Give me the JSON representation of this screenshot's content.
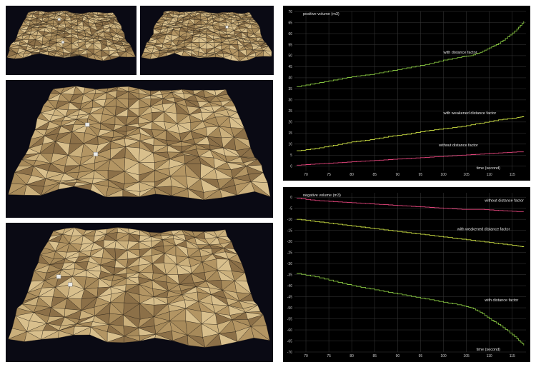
{
  "colors": {
    "terrain_light": "#cbb07c",
    "terrain_mid": "#b39563",
    "terrain_dark": "#8c7048",
    "terrain_line": "#2a2318",
    "panel_bg": "#0a0a14",
    "chart_bg": "#000000",
    "grid": "#3a3a3a",
    "series_green": "#86c441",
    "series_yellow": "#cde043",
    "series_pink": "#e0447a"
  },
  "chart_data": [
    {
      "type": "line",
      "ylabel": "positive volume (m3)",
      "xlabel": "time (second)",
      "xlim": [
        67.5,
        118
      ],
      "ylim": [
        -2,
        70
      ],
      "xticks": [
        70,
        75,
        80,
        85,
        90,
        95,
        100,
        105,
        110,
        115
      ],
      "yticks": [
        0,
        5,
        10,
        15,
        20,
        25,
        30,
        35,
        40,
        45,
        50,
        55,
        60,
        65,
        70
      ],
      "grid": true,
      "series": [
        {
          "name": "with distance factor",
          "color": "#86c441",
          "x": [
            68,
            72,
            76,
            80,
            84,
            88,
            92,
            96,
            100,
            104,
            106,
            108,
            110,
            112,
            114,
            116,
            117.5
          ],
          "y": [
            36,
            37.5,
            39,
            40.5,
            41.5,
            43,
            44.5,
            46,
            48,
            49.5,
            50,
            51.5,
            53.5,
            55.5,
            58.5,
            62,
            65.5
          ],
          "label_x": 100,
          "label_y": 51
        },
        {
          "name": "with weakened distance factor",
          "color": "#cde043",
          "x": [
            68,
            72,
            76,
            80,
            84,
            88,
            92,
            96,
            100,
            104,
            108,
            112,
            116,
            117.5
          ],
          "y": [
            7,
            8,
            9.5,
            11,
            12,
            13.5,
            14.5,
            16,
            17,
            18,
            19.5,
            21,
            22,
            22.5
          ],
          "label_x": 100,
          "label_y": 23.5
        },
        {
          "name": "without distance factor",
          "color": "#e0447a",
          "x": [
            68,
            72,
            76,
            80,
            84,
            88,
            92,
            96,
            100,
            104,
            108,
            112,
            116,
            117.5
          ],
          "y": [
            0.5,
            1,
            1.5,
            2,
            2.5,
            3,
            3.5,
            4,
            4.5,
            5,
            5.5,
            6,
            6.5,
            6.5
          ],
          "label_x": 99,
          "label_y": 9
        }
      ]
    },
    {
      "type": "line",
      "ylabel": "negative volume (m3)",
      "xlabel": "time (second)",
      "xlim": [
        67.5,
        118
      ],
      "ylim": [
        -70,
        2
      ],
      "xticks": [
        70,
        75,
        80,
        85,
        90,
        95,
        100,
        105,
        110,
        115
      ],
      "yticks": [
        0,
        -5,
        -10,
        -15,
        -20,
        -25,
        -30,
        -35,
        -40,
        -45,
        -50,
        -55,
        -60,
        -65,
        -70
      ],
      "grid": true,
      "series": [
        {
          "name": "without distance factor",
          "color": "#e0447a",
          "x": [
            68,
            72,
            76,
            80,
            84,
            88,
            92,
            96,
            100,
            104,
            108,
            112,
            116,
            117.5
          ],
          "y": [
            -0.5,
            -1.5,
            -2,
            -2.5,
            -3,
            -3.5,
            -4,
            -4.5,
            -5,
            -5.5,
            -5.5,
            -6,
            -6.5,
            -6.5
          ],
          "label_x": 109,
          "label_y": -2
        },
        {
          "name": "with weakened distance factor",
          "color": "#cde043",
          "x": [
            68,
            72,
            76,
            80,
            84,
            88,
            92,
            96,
            100,
            104,
            108,
            112,
            116,
            117.5
          ],
          "y": [
            -10,
            -11,
            -12,
            -13,
            -14,
            -15,
            -16,
            -17,
            -18,
            -19,
            -20,
            -21,
            -22,
            -22.5
          ],
          "label_x": 103,
          "label_y": -15
        },
        {
          "name": "with distance factor",
          "color": "#86c441",
          "x": [
            68,
            72,
            76,
            80,
            84,
            88,
            92,
            96,
            100,
            104,
            106,
            108,
            110,
            112,
            114,
            116,
            117.5
          ],
          "y": [
            -34.5,
            -36,
            -38,
            -40,
            -41.5,
            -43,
            -44.5,
            -46,
            -47.5,
            -49,
            -50,
            -52,
            -55,
            -57.5,
            -60.5,
            -64,
            -67
          ],
          "label_x": 109,
          "label_y": -47
        }
      ]
    }
  ]
}
